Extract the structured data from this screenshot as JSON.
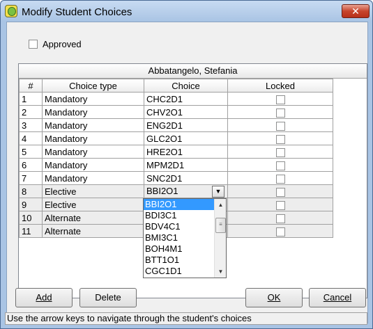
{
  "window": {
    "title": "Modify Student Choices",
    "close_glyph": "✕"
  },
  "approved": {
    "label": "Approved",
    "checked": false
  },
  "grid": {
    "student_name": "Abbatangelo, Stefania",
    "columns": [
      "#",
      "Choice type",
      "Choice",
      "Locked"
    ],
    "rows": [
      {
        "num": "1",
        "type": "Mandatory",
        "choice": "CHC2D1"
      },
      {
        "num": "2",
        "type": "Mandatory",
        "choice": "CHV2O1"
      },
      {
        "num": "3",
        "type": "Mandatory",
        "choice": "ENG2D1"
      },
      {
        "num": "4",
        "type": "Mandatory",
        "choice": "GLC2O1"
      },
      {
        "num": "5",
        "type": "Mandatory",
        "choice": "HRE2O1"
      },
      {
        "num": "6",
        "type": "Mandatory",
        "choice": "MPM2D1"
      },
      {
        "num": "7",
        "type": "Mandatory",
        "choice": "SNC2D1"
      },
      {
        "num": "8",
        "type": "Elective",
        "choice": "BBI2O1"
      },
      {
        "num": "9",
        "type": "Elective",
        "choice": ""
      },
      {
        "num": "10",
        "type": "Alternate",
        "choice": ""
      },
      {
        "num": "11",
        "type": "Alternate",
        "choice": ""
      }
    ]
  },
  "dropdown": {
    "options": [
      "BBI2O1",
      "BDI3C1",
      "BDV4C1",
      "BMI3C1",
      "BOH4M1",
      "BTT1O1",
      "CGC1D1"
    ],
    "selected": "BBI2O1",
    "arrow_glyph": "▼",
    "scroll_up_glyph": "▲",
    "scroll_down_glyph": "▼",
    "thumb_glyph": "≡"
  },
  "buttons": {
    "add": "Add",
    "delete": "Delete",
    "ok": "OK",
    "cancel": "Cancel"
  },
  "status": "Use the arrow keys to navigate through the student's choices"
}
